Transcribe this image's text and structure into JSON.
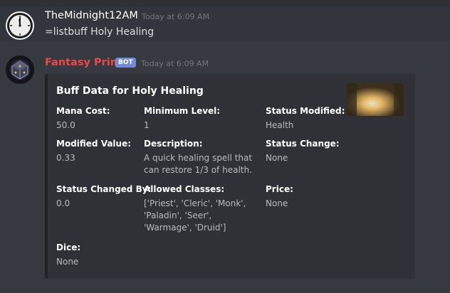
{
  "messages": [
    {
      "username": "TheMidnight12AM",
      "timestamp": "Today at 6:09 AM",
      "content": "=listbuff Holy Healing"
    },
    {
      "username": "Fantasy Prime",
      "bot_tag": "BOT",
      "timestamp": "Today at 6:09 AM",
      "embed": {
        "title": "Buff Data for Holy Healing",
        "fields": [
          {
            "name": "Mana Cost:",
            "value": "50.0"
          },
          {
            "name": "Minimum Level:",
            "value": "1"
          },
          {
            "name": "Status Modified:",
            "value": "Health"
          },
          {
            "name": "Modified Value:",
            "value": "0.33"
          },
          {
            "name": "Description:",
            "value": "A quick healing spell that can restore 1/3 of health."
          },
          {
            "name": "Status Change:",
            "value": "None"
          },
          {
            "name": "Status Changed By:",
            "value": "0.0"
          },
          {
            "name": "Allowed Classes:",
            "value": "['Priest', 'Cleric', 'Monk', 'Paladin', 'Seer', 'Warmage', 'Druid']"
          },
          {
            "name": "Price:",
            "value": "None"
          },
          {
            "name": "Dice:",
            "value": "None"
          }
        ]
      }
    }
  ],
  "colors": {
    "background": "#36393f",
    "bot_name": "#f04747",
    "bot_tag": "#7289da",
    "embed_bg": "#2f3136"
  }
}
